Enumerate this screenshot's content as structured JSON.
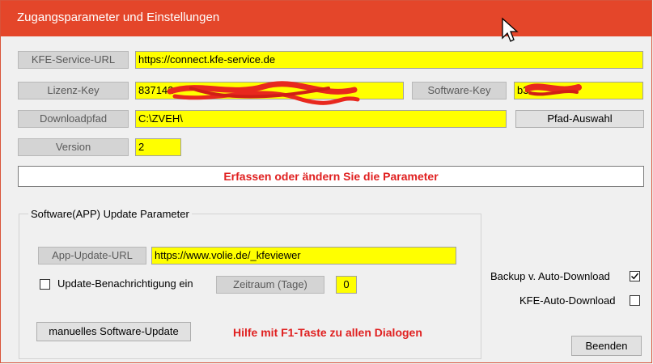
{
  "window": {
    "title": "Zugangsparameter und Einstellungen",
    "title_color": "#e4462a"
  },
  "fields": {
    "service_url": {
      "label": "KFE-Service-URL",
      "value": "https://connect.kfe-service.de"
    },
    "license_key": {
      "label": "Lizenz-Key",
      "value": "837142"
    },
    "software_key": {
      "label": "Software-Key",
      "value": "b3"
    },
    "download_path": {
      "label": "Downloadpfad",
      "value": "C:\\ZVEH\\"
    },
    "version": {
      "label": "Version",
      "value": "2"
    }
  },
  "buttons": {
    "path_select": "Pfad-Auswahl",
    "manual_update": "manuelles Software-Update",
    "close": "Beenden"
  },
  "status": {
    "message": "Erfassen oder ändern Sie die Parameter",
    "color": "#e02020"
  },
  "update_group": {
    "title": "Software(APP) Update Parameter",
    "app_update_url_label": "App-Update-URL",
    "app_update_url": "https://www.volie.de/_kfeviewer",
    "notify_label": "Update-Benachrichtigung ein",
    "notify_checked": false,
    "period_label": "Zeitraum (Tage)",
    "period_value": "0"
  },
  "options": {
    "backup_label": "Backup v. Auto-Download",
    "backup_checked": true,
    "auto_download_label": "KFE-Auto-Download",
    "auto_download_checked": false
  },
  "help": {
    "text": "Hilfe mit F1-Taste zu allen Dialogen",
    "color": "#e02020"
  },
  "colors": {
    "field_bg": "#ffff00",
    "redaction": "#e8281e"
  }
}
